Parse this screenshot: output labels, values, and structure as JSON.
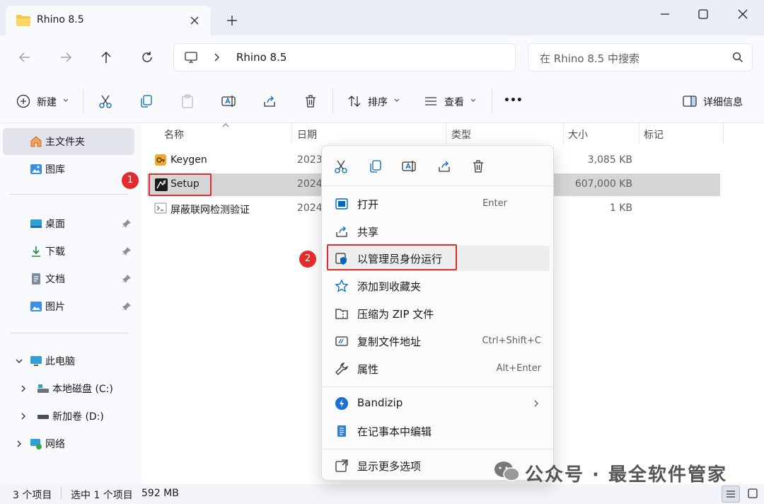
{
  "window": {
    "tab_title": "Rhino 8.5",
    "close_tab": "×",
    "new_tab": "+"
  },
  "address": {
    "location": "Rhino 8.5",
    "search_placeholder": "在 Rhino 8.5 中搜索"
  },
  "toolbar": {
    "new_label": "新建",
    "sort_label": "排序",
    "view_label": "查看",
    "more_label": "•••",
    "details_label": "详细信息"
  },
  "sidebar": {
    "home": "主文件夹",
    "gallery": "图库",
    "desktop": "桌面",
    "downloads": "下载",
    "documents": "文档",
    "pictures": "图片",
    "this_pc": "此电脑",
    "local_disk": "本地磁盘 (C:)",
    "new_volume": "新加卷 (D:)",
    "network": "网络"
  },
  "columns": {
    "name": "名称",
    "date": "日期",
    "type": "类型",
    "size": "大小",
    "tags": "标记"
  },
  "files": [
    {
      "name": "Keygen",
      "date": "2023",
      "size": "3,085 KB"
    },
    {
      "name": "Setup",
      "date": "2024",
      "size": "607,000 KB"
    },
    {
      "name": "屏蔽联网检测验证",
      "date": "2024",
      "size": "1 KB"
    }
  ],
  "context_menu": {
    "open": "打开",
    "open_short": "Enter",
    "share": "共享",
    "run_as_admin": "以管理员身份运行",
    "add_favorites": "添加到收藏夹",
    "compress_zip": "压缩为 ZIP 文件",
    "copy_path": "复制文件地址",
    "copy_path_short": "Ctrl+Shift+C",
    "properties": "属性",
    "properties_short": "Alt+Enter",
    "bandizip": "Bandizip",
    "notepad": "在记事本中编辑",
    "more_options": "显示更多选项"
  },
  "badges": {
    "one": "1",
    "two": "2"
  },
  "status": {
    "count": "3 个项目",
    "selected": "选中 1 个项目",
    "size": "592 MB"
  },
  "watermark": "公众号 · 最全软件管家",
  "colors": {
    "accent": "#0067c0",
    "highlight_red": "#e02c2c",
    "folder_yellow": "#f7c744"
  }
}
